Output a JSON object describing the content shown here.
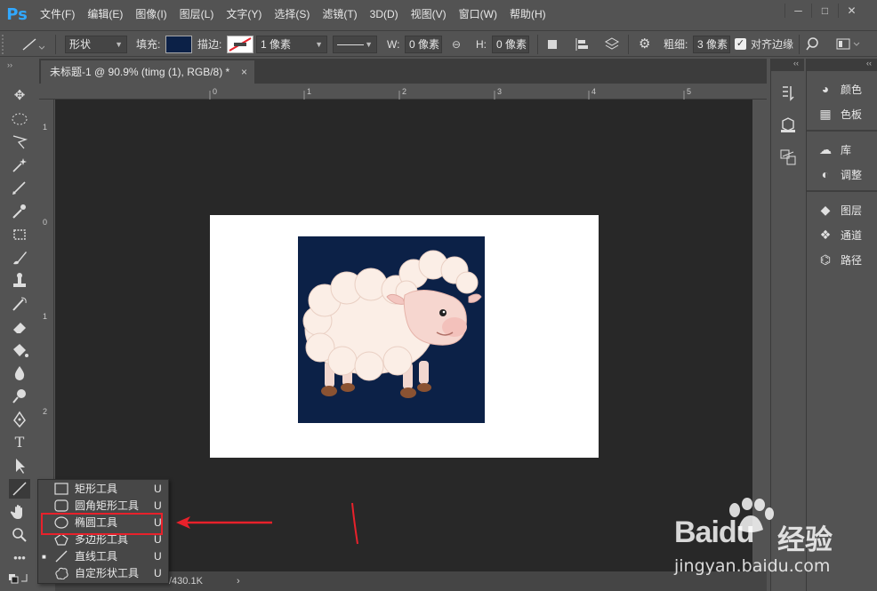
{
  "app": {
    "logo": "Ps"
  },
  "menu": [
    "文件(F)",
    "编辑(E)",
    "图像(I)",
    "图层(L)",
    "文字(Y)",
    "选择(S)",
    "滤镜(T)",
    "3D(D)",
    "视图(V)",
    "窗口(W)",
    "帮助(H)"
  ],
  "window_controls": {
    "minimize": "─",
    "restore": "□",
    "close": "✕"
  },
  "options": {
    "mode": "形状",
    "fill_label": "填充:",
    "fill_color": "#0c2147",
    "stroke_label": "描边:",
    "stroke_width": "1 像素",
    "w_label": "W:",
    "w_value": "0 像素",
    "h_label": "H:",
    "h_value": "0 像素",
    "weight_label": "粗细:",
    "weight_value": "3 像素",
    "align_edges_label": "对齐边缘",
    "align_edges_checked": true
  },
  "document": {
    "tab_title": "未标题-1 @ 90.9% (timg (1), RGB/8) *",
    "close": "×",
    "status": "/430.1K",
    "status_arrow": "›",
    "canvas_bg": "#282828",
    "photo_bg": "#0c2147"
  },
  "rulers": {
    "top": [
      "0",
      "1",
      "2",
      "3",
      "4",
      "5"
    ],
    "left": [
      "1",
      "0",
      "1",
      "2"
    ]
  },
  "panels": {
    "collapse": "‹‹",
    "groups": [
      [
        {
          "icon": "palette-icon",
          "label": "颜色"
        },
        {
          "icon": "swatches-icon",
          "label": "色板"
        }
      ],
      [
        {
          "icon": "cloud-library-icon",
          "label": "库"
        },
        {
          "icon": "adjustments-icon",
          "label": "调整"
        }
      ],
      [
        {
          "icon": "layers-icon",
          "label": "图层"
        },
        {
          "icon": "channels-icon",
          "label": "通道"
        },
        {
          "icon": "paths-icon",
          "label": "路径"
        }
      ]
    ]
  },
  "shape_flyout": {
    "items": [
      {
        "label": "矩形工具",
        "key": "U",
        "icon": "rectangle-tool-icon",
        "current": false
      },
      {
        "label": "圆角矩形工具",
        "key": "U",
        "icon": "rounded-rectangle-tool-icon",
        "current": false
      },
      {
        "label": "椭圆工具",
        "key": "U",
        "icon": "ellipse-tool-icon",
        "current": false,
        "highlighted": true
      },
      {
        "label": "多边形工具",
        "key": "U",
        "icon": "polygon-tool-icon",
        "current": false
      },
      {
        "label": "直线工具",
        "key": "U",
        "icon": "line-tool-icon",
        "current": true
      },
      {
        "label": "自定形状工具",
        "key": "U",
        "icon": "custom-shape-tool-icon",
        "current": false
      }
    ]
  },
  "annotation": {
    "color": "#e8212b"
  },
  "watermark": {
    "brand": "Baidu",
    "cn": "经验",
    "url": "jingyan.baidu.com"
  }
}
